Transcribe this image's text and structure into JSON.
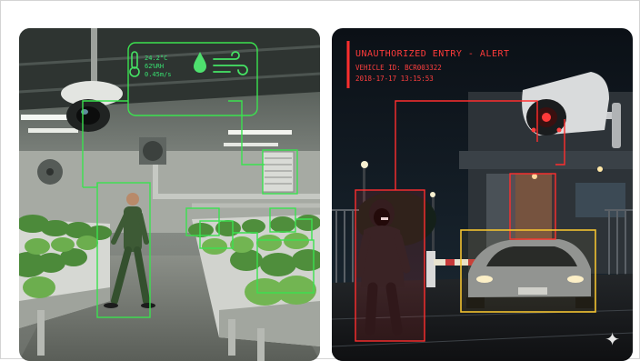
{
  "left_image": {
    "sensor": {
      "temperature": "24.2°C",
      "humidity": "62%RH",
      "airflow": "0.45m/s"
    },
    "colors": {
      "detect": "#3be24f",
      "detect_glow": "#8dff8d"
    },
    "icons": [
      "thermometer-icon",
      "water-drop-icon",
      "wind-icon",
      "security-camera-icon"
    ]
  },
  "right_image": {
    "alert": {
      "title": "UNAUTHORIZED ENTRY - ALERT",
      "vehicle_id": "VEHICLE ID: BCR003322",
      "timestamp": "2018-17-17 13:15:53"
    },
    "colors": {
      "alert": "#ff2e2e",
      "vehicle_box": "#f2c230"
    },
    "icons": [
      "security-camera-icon",
      "sparkle-icon"
    ]
  }
}
